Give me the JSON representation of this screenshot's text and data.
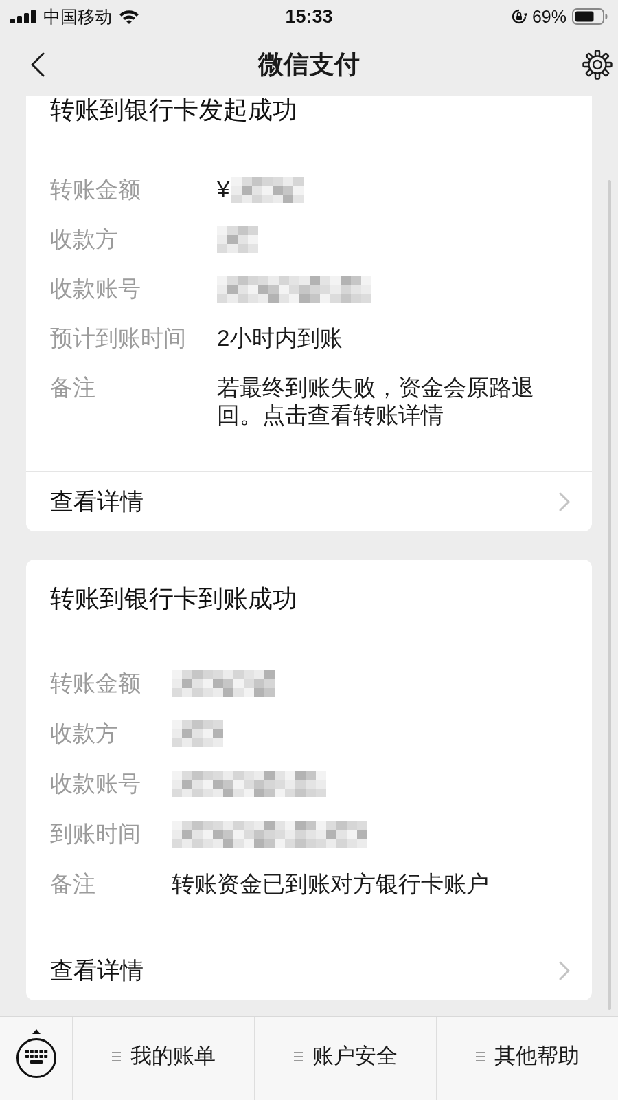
{
  "status_bar": {
    "carrier": "中国移动",
    "time": "15:33",
    "battery": "69%"
  },
  "nav_bar": {
    "title": "微信支付"
  },
  "cards": [
    {
      "title": "转账到银行卡发起成功",
      "fields": [
        {
          "label": "转账金额",
          "kind": "redacted",
          "prefix": "¥"
        },
        {
          "label": "收款方",
          "kind": "redacted"
        },
        {
          "label": "收款账号",
          "kind": "redacted"
        },
        {
          "label": "预计到账时间",
          "kind": "text",
          "value": "2小时内到账"
        },
        {
          "label": "备注",
          "kind": "text",
          "value": "若最终到账失败，资金会原路退回。点击查看转账详情"
        }
      ],
      "link": "查看详情"
    },
    {
      "title": "转账到银行卡到账成功",
      "fields": [
        {
          "label": "转账金额",
          "kind": "redacted"
        },
        {
          "label": "收款方",
          "kind": "redacted"
        },
        {
          "label": "收款账号",
          "kind": "redacted"
        },
        {
          "label": "到账时间",
          "kind": "redacted"
        },
        {
          "label": "备注",
          "kind": "text",
          "value": "转账资金已到账对方银行卡账户"
        }
      ],
      "link": "查看详情"
    }
  ],
  "bottom_menu": {
    "items": [
      "我的账单",
      "账户安全",
      "其他帮助"
    ]
  }
}
